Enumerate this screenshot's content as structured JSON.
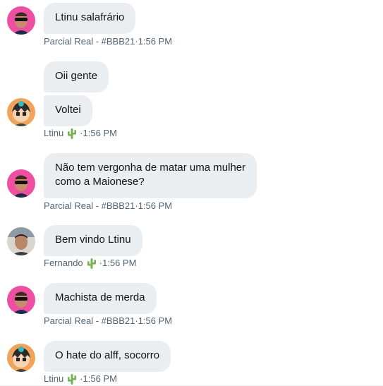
{
  "messages": [
    {
      "text": "Ltinu salafrário"
    },
    {
      "text": "Oii gente"
    },
    {
      "text": "Voltei"
    },
    {
      "text": "Não tem vergonha de matar uma mulher\ncomo a Maionese?"
    },
    {
      "text": "Bem vindo Ltinu"
    },
    {
      "text": "Machista de merda"
    },
    {
      "text": "O hate do alff, socorro"
    }
  ],
  "meta": [
    {
      "sender": "Parcial Real - #BBB21",
      "sep": " · ",
      "time": "1:56 PM"
    },
    {
      "sender": "Ltinu",
      "sep": "· ",
      "time": "1:56 PM",
      "emoji": "cactus-icon"
    },
    {
      "sender": "Parcial Real - #BBB21",
      "sep": " · ",
      "time": "1:56 PM"
    },
    {
      "sender": "Fernando",
      "sep": "· ",
      "time": "1:56 PM",
      "emoji": "cactus-icon"
    },
    {
      "sender": "Parcial Real - #BBB21",
      "sep": " · ",
      "time": "1:56 PM"
    },
    {
      "sender": "Ltinu",
      "sep": "· ",
      "time": "1:56 PM",
      "emoji": "cactus-icon"
    }
  ],
  "colors": {
    "bubble": "#ebeef0",
    "meta_text": "#536471",
    "message_text": "#0f1419",
    "avatar_pink": "#ee4fa0",
    "avatar_orange": "#f2a35b",
    "cactus_green": "#77b255"
  }
}
